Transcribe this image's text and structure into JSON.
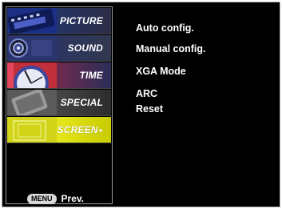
{
  "sidebar": {
    "items": [
      {
        "label": "PICTURE",
        "icon": "picture-thumbnail-icon"
      },
      {
        "label": "SOUND",
        "icon": "speaker-thumbnail-icon"
      },
      {
        "label": "TIME",
        "icon": "clock-thumbnail-icon"
      },
      {
        "label": "SPECIAL",
        "icon": "special-thumbnail-icon"
      },
      {
        "label": "SCREEN",
        "icon": "screen-thumbnail-icon",
        "selected": true,
        "arrow": "▸"
      }
    ],
    "menu_button": "MENU",
    "prev_label": "Prev."
  },
  "options": [
    "Auto config.",
    "Manual config.",
    "XGA Mode",
    "ARC",
    "Reset"
  ],
  "colors": {
    "background": "#000000",
    "selected": "#d6d80a",
    "text": "#ffffff"
  }
}
